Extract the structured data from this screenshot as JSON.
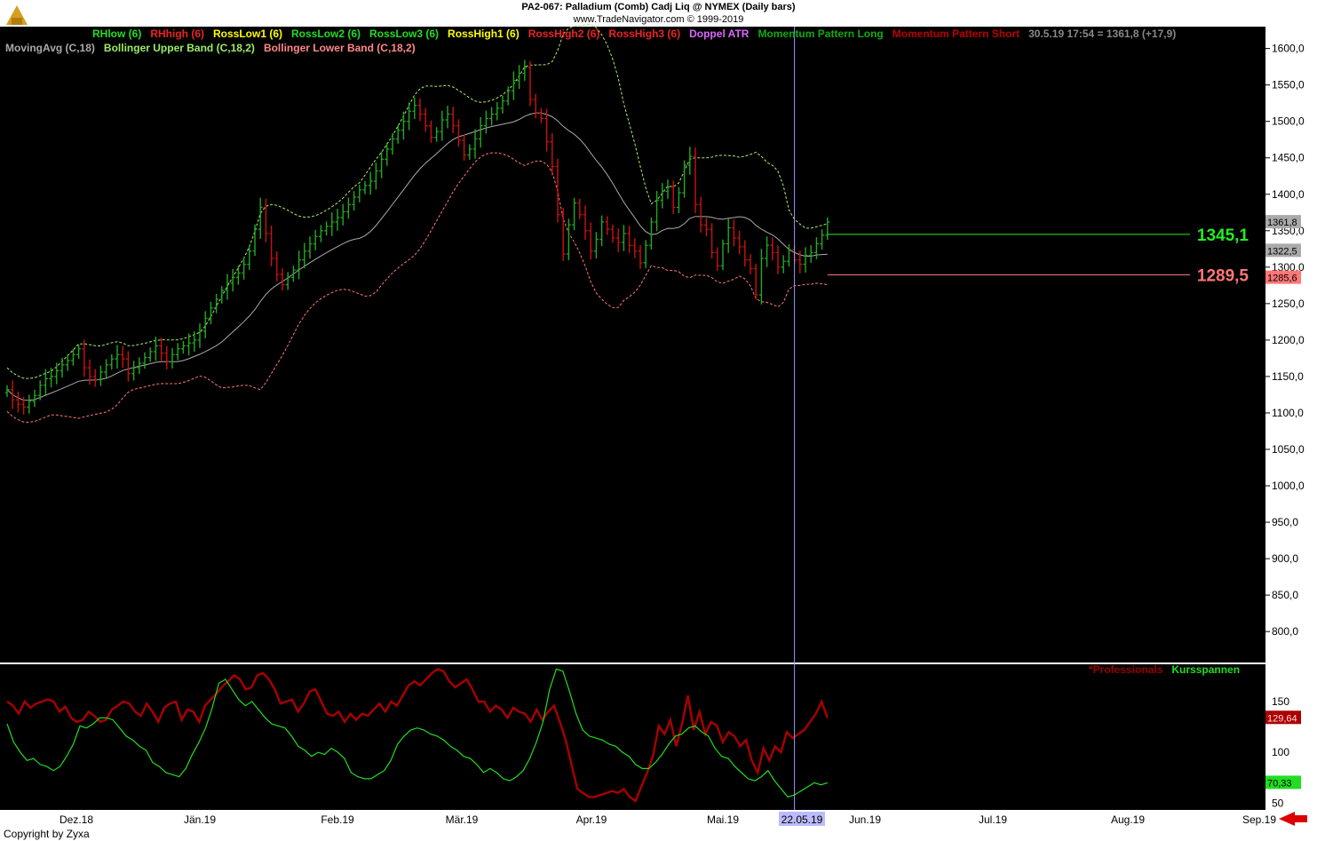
{
  "header": {
    "line1": "PA2-067:  Palladium (Comb) Cadj Liq @ NYMEX  (Daily bars)",
    "line2": "www.TradeNavigator.com © 1999-2019"
  },
  "legend_row1": [
    {
      "label": "RHlow (6)",
      "color": "#22dd22"
    },
    {
      "label": "RHhigh (6)",
      "color": "#ee2222"
    },
    {
      "label": "RossLow1 (6)",
      "color": "#ffff00"
    },
    {
      "label": "RossLow2 (6)",
      "color": "#22dd22"
    },
    {
      "label": "RossLow3 (6)",
      "color": "#22dd22"
    },
    {
      "label": "RossHigh1 (6)",
      "color": "#ffff00"
    },
    {
      "label": "RossHigh2 (6)",
      "color": "#ee2222"
    },
    {
      "label": "RossHigh3 (6)",
      "color": "#ee2222"
    },
    {
      "label": "Doppel ATR",
      "color": "#dd66ff"
    },
    {
      "label": "Momentum Pattern Long",
      "color": "#11aa11"
    },
    {
      "label": "Momentum Pattern Short",
      "color": "#bb0000"
    },
    {
      "label": "30.5.19 17:54 = 1361,8 (+17,9)",
      "color": "#888888"
    }
  ],
  "legend_row2": [
    {
      "label": "MovingAvg (C,18)",
      "color": "#aaaaaa"
    },
    {
      "label": "Bollinger Upper Band (C,18,2)",
      "color": "#99ee66"
    },
    {
      "label": "Bollinger Lower Band (C,18,2)",
      "color": "#ff8888"
    }
  ],
  "lower_legend": [
    {
      "label": "*Professionals",
      "color": "#990000"
    },
    {
      "label": "Kursspannen",
      "color": "#22dd22"
    }
  ],
  "copyright": "Copyright by Zyxa",
  "chart_data": [
    {
      "type": "ohlc",
      "title": "",
      "ylim": [
        760,
        1630
      ],
      "y_ticks": [
        "1600,0",
        "1550,0",
        "1500,0",
        "1450,0",
        "1400,0",
        "1350,0",
        "1300,0",
        "1250,0",
        "1200,0",
        "1150,0",
        "1100,0",
        "1050,0",
        "1000,0",
        "950,0",
        "900,0",
        "850,0",
        "800,0"
      ],
      "x_ticks": [
        "Dez.18",
        "Jän.19",
        "Feb.19",
        "Mär.19",
        "Apr.19",
        "Mai.19",
        "22.05.19",
        "Jun.19",
        "Jul.19",
        "Aug.19",
        "Sep.19"
      ],
      "closes_approx": [
        1132,
        1118,
        1112,
        1108,
        1116,
        1124,
        1138,
        1147,
        1150,
        1158,
        1166,
        1172,
        1180,
        1188,
        1162,
        1150,
        1146,
        1156,
        1166,
        1174,
        1180,
        1174,
        1154,
        1162,
        1168,
        1176,
        1184,
        1192,
        1182,
        1170,
        1180,
        1188,
        1192,
        1196,
        1200,
        1212,
        1230,
        1244,
        1256,
        1268,
        1278,
        1286,
        1292,
        1304,
        1322,
        1352,
        1382,
        1346,
        1312,
        1290,
        1276,
        1286,
        1296,
        1310,
        1322,
        1332,
        1342,
        1350,
        1356,
        1362,
        1368,
        1376,
        1386,
        1396,
        1406,
        1412,
        1418,
        1432,
        1448,
        1462,
        1476,
        1488,
        1500,
        1514,
        1522,
        1510,
        1494,
        1478,
        1486,
        1502,
        1510,
        1494,
        1474,
        1454,
        1462,
        1476,
        1494,
        1504,
        1510,
        1518,
        1528,
        1542,
        1556,
        1566,
        1574,
        1530,
        1512,
        1504,
        1472,
        1438,
        1372,
        1318,
        1358,
        1388,
        1372,
        1350,
        1322,
        1338,
        1362,
        1352,
        1340,
        1334,
        1346,
        1330,
        1322,
        1306,
        1330,
        1362,
        1392,
        1404,
        1410,
        1382,
        1402,
        1440,
        1452,
        1386,
        1358,
        1352,
        1320,
        1302,
        1332,
        1354,
        1340,
        1328,
        1310,
        1298,
        1262,
        1312,
        1330,
        1320,
        1300,
        1308,
        1324,
        1310,
        1304,
        1316,
        1320,
        1332,
        1344,
        1361.8
      ],
      "horizontal_levels": [
        {
          "value": 1345.1,
          "label": "1345,1",
          "color": "#22ee22"
        },
        {
          "value": 1289.5,
          "label": "1289,5",
          "color": "#ff7777"
        }
      ],
      "right_price_tags": [
        {
          "value": 1361.8,
          "label": "1361,8",
          "bg": "#aaaaaa",
          "fg": "#000000"
        },
        {
          "value": 1322.5,
          "label": "1322,5",
          "bg": "#aaaaaa",
          "fg": "#000000"
        },
        {
          "value": 1285.6,
          "label": "1285,6",
          "bg": "#ff7777",
          "fg": "#000000"
        }
      ],
      "date_marker": "22.05.19"
    },
    {
      "type": "line",
      "title": "",
      "ylim": [
        45,
        185
      ],
      "y_ticks": [
        "150",
        "100",
        "50"
      ],
      "series": [
        {
          "name": "*Professionals",
          "color": "#aa0000",
          "values": [
            150,
            146,
            138,
            150,
            144,
            148,
            150,
            152,
            150,
            140,
            145,
            134,
            130,
            132,
            140,
            136,
            130,
            132,
            142,
            146,
            150,
            148,
            140,
            136,
            148,
            140,
            130,
            144,
            148,
            150,
            132,
            142,
            140,
            130,
            146,
            152,
            158,
            165,
            170,
            176,
            172,
            162,
            164,
            176,
            178,
            172,
            162,
            148,
            150,
            152,
            140,
            148,
            160,
            162,
            150,
            138,
            136,
            140,
            130,
            138,
            132,
            138,
            136,
            142,
            148,
            140,
            150,
            146,
            156,
            166,
            170,
            166,
            172,
            178,
            182,
            180,
            170,
            164,
            168,
            172,
            162,
            150,
            150,
            140,
            146,
            142,
            134,
            144,
            140,
            138,
            130,
            142,
            132,
            140,
            146,
            130,
            112,
            88,
            64,
            60,
            56,
            56,
            58,
            60,
            62,
            60,
            64,
            56,
            52,
            66,
            80,
            96,
            126,
            118,
            132,
            106,
            128,
            156,
            122,
            140,
            118,
            130,
            126,
            110,
            120,
            116,
            106,
            112,
            92,
            80,
            104,
            92,
            106,
            100,
            120,
            114,
            118,
            122,
            130,
            138,
            150,
            134
          ],
          "last_label": "129,64"
        },
        {
          "name": "Kursspannen",
          "color": "#22dd22",
          "values": [
            128,
            110,
            100,
            92,
            94,
            88,
            86,
            82,
            86,
            96,
            108,
            126,
            124,
            128,
            134,
            134,
            132,
            124,
            116,
            112,
            106,
            102,
            90,
            86,
            80,
            78,
            76,
            84,
            98,
            110,
            124,
            144,
            168,
            172,
            162,
            152,
            146,
            150,
            142,
            134,
            128,
            126,
            124,
            116,
            106,
            102,
            96,
            100,
            98,
            104,
            100,
            94,
            80,
            76,
            74,
            74,
            78,
            82,
            92,
            108,
            116,
            122,
            124,
            122,
            118,
            116,
            112,
            106,
            102,
            96,
            94,
            88,
            80,
            84,
            80,
            74,
            72,
            76,
            82,
            94,
            110,
            130,
            162,
            182,
            180,
            160,
            138,
            122,
            116,
            114,
            112,
            108,
            106,
            100,
            96,
            88,
            84,
            84,
            90,
            98,
            108,
            116,
            118,
            124,
            126,
            120,
            116,
            104,
            96,
            94,
            86,
            80,
            74,
            72,
            76,
            82,
            72,
            64,
            56,
            58,
            62,
            66,
            70,
            68,
            70
          ],
          "last_label": "70,33"
        }
      ]
    }
  ]
}
